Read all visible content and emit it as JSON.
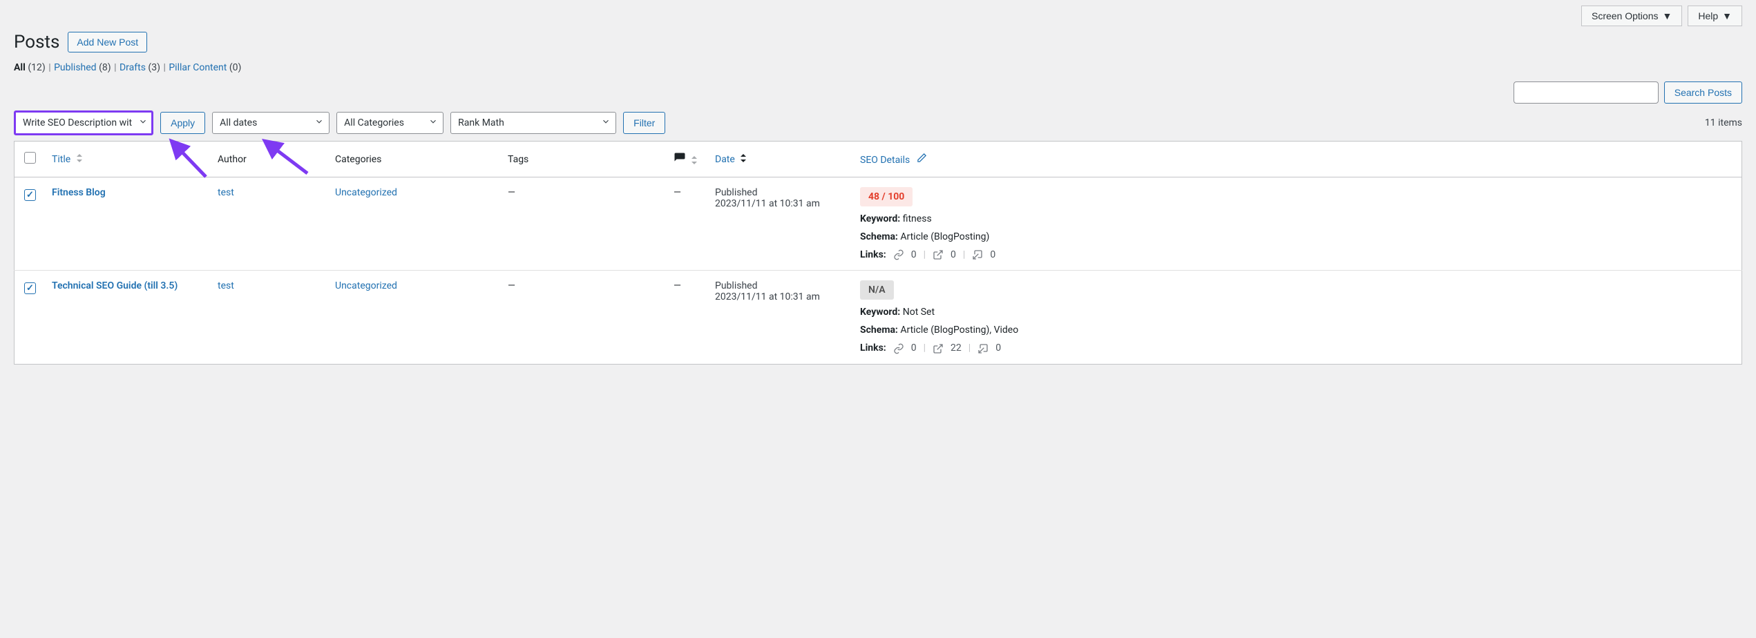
{
  "top": {
    "screen_options": "Screen Options",
    "help": "Help"
  },
  "header": {
    "title": "Posts",
    "add_new": "Add New Post"
  },
  "views": {
    "all_label": "All",
    "all_count": "(12)",
    "published_label": "Published",
    "published_count": "(8)",
    "drafts_label": "Drafts",
    "drafts_count": "(3)",
    "pillar_label": "Pillar Content",
    "pillar_count": "(0)"
  },
  "search": {
    "button": "Search Posts"
  },
  "bulk": {
    "action_selected": "Write SEO Description wit",
    "apply": "Apply",
    "dates": "All dates",
    "categories": "All Categories",
    "rankmath": "Rank Math",
    "filter": "Filter",
    "items_count": "11 items"
  },
  "columns": {
    "title": "Title",
    "author": "Author",
    "categories": "Categories",
    "tags": "Tags",
    "date": "Date",
    "seo": "SEO Details"
  },
  "posts": [
    {
      "checked": true,
      "title": "Fitness Blog",
      "author": "test",
      "category": "Uncategorized",
      "tags": "—",
      "comments": "—",
      "date_status": "Published",
      "date_time": "2023/11/11 at 10:31 am",
      "seo": {
        "score": "48 / 100",
        "score_kind": "bad",
        "keyword_label": "Keyword:",
        "keyword_value": "fitness",
        "schema_label": "Schema:",
        "schema_value": "Article (BlogPosting)",
        "links_label": "Links:",
        "internal": "0",
        "external": "0",
        "incoming": "0"
      }
    },
    {
      "checked": true,
      "title": "Technical SEO Guide (till 3.5)",
      "author": "test",
      "category": "Uncategorized",
      "tags": "—",
      "comments": "—",
      "date_status": "Published",
      "date_time": "2023/11/11 at 10:31 am",
      "seo": {
        "score": "N/A",
        "score_kind": "na",
        "keyword_label": "Keyword:",
        "keyword_value": "Not Set",
        "schema_label": "Schema:",
        "schema_value": "Article (BlogPosting), Video",
        "links_label": "Links:",
        "internal": "0",
        "external": "22",
        "incoming": "0"
      }
    }
  ]
}
